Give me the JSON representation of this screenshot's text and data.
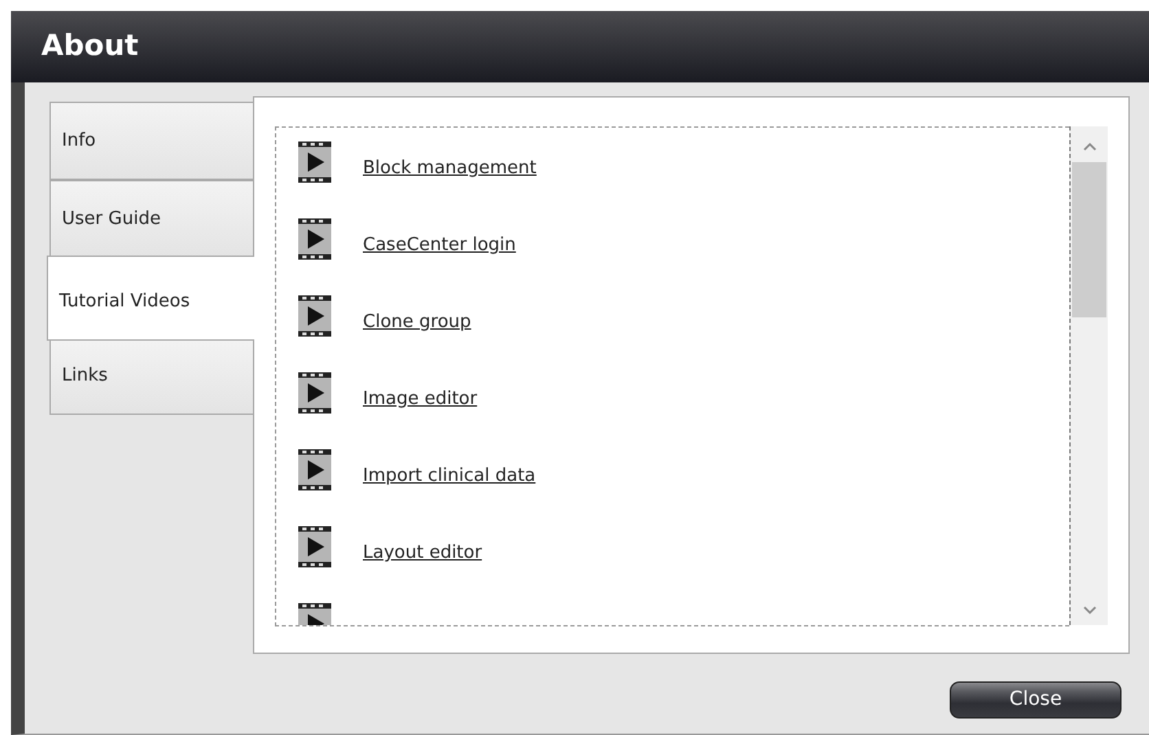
{
  "window": {
    "title": "About"
  },
  "tabs": [
    {
      "label": "Info",
      "selected": false
    },
    {
      "label": "User Guide",
      "selected": false
    },
    {
      "label": "Tutorial Videos",
      "selected": true
    },
    {
      "label": "Links",
      "selected": false
    }
  ],
  "videos": [
    {
      "label": "Block management"
    },
    {
      "label": "CaseCenter login"
    },
    {
      "label": "Clone group"
    },
    {
      "label": "Image editor"
    },
    {
      "label": "Import clinical data"
    },
    {
      "label": "Layout editor"
    }
  ],
  "cut_off_row": true,
  "buttons": [
    "Close"
  ]
}
